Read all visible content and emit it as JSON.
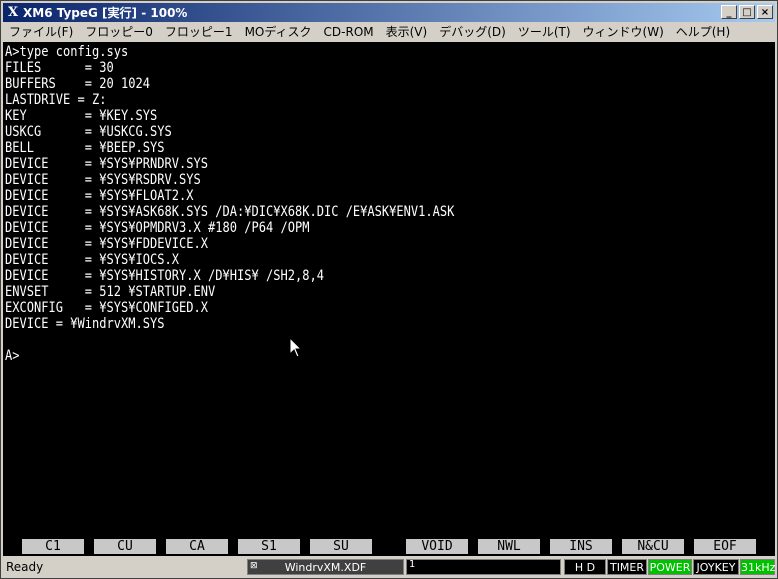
{
  "window": {
    "title": "XM6 TypeG [実行] - 100%",
    "app_icon": "X",
    "buttons": [
      "_",
      "□",
      "×"
    ]
  },
  "menu": [
    "ファイル(F)",
    "フロッピー0",
    "フロッピー1",
    "MOディスク",
    "CD-ROM",
    "表示(V)",
    "デバッグ(D)",
    "ツール(T)",
    "ウィンドウ(W)",
    "ヘルプ(H)"
  ],
  "terminal": {
    "lines": [
      "A>type config.sys",
      "FILES      = 30",
      "BUFFERS    = 20 1024",
      "LASTDRIVE = Z:",
      "KEY        = ¥KEY.SYS",
      "USKCG      = ¥USKCG.SYS",
      "BELL       = ¥BEEP.SYS",
      "DEVICE     = ¥SYS¥PRNDRV.SYS",
      "DEVICE     = ¥SYS¥RSDRV.SYS",
      "DEVICE     = ¥SYS¥FLOAT2.X",
      "DEVICE     = ¥SYS¥ASK68K.SYS /DA:¥DIC¥X68K.DIC /E¥ASK¥ENV1.ASK",
      "DEVICE     = ¥SYS¥OPMDRV3.X #180 /P64 /OPM",
      "DEVICE     = ¥SYS¥FDDEVICE.X",
      "DEVICE     = ¥SYS¥IOCS.X",
      "DEVICE     = ¥SYS¥HISTORY.X /D¥HIS¥ /SH2,8,4",
      "ENVSET     = 512 ¥STARTUP.ENV",
      "EXCONFIG   = ¥SYS¥CONFIGED.X",
      "DEVICE = ¥WindrvXM.SYS",
      "",
      "A>"
    ]
  },
  "fkeys": [
    "C1",
    "CU",
    "CA",
    "S1",
    "SU",
    "VOID",
    "NWL",
    "INS",
    "N&CU",
    "EOF"
  ],
  "status": {
    "ready": "Ready",
    "file": "WindrvXM.XDF",
    "file_icon": "⊠",
    "number": "1",
    "hd": "H D",
    "timer": "TIMER",
    "power": "POWER",
    "joykey": "JOYKEY",
    "freq": "31kHz"
  },
  "colors": {
    "power_bg": "#00c000",
    "freq_bg": "#00c000",
    "titlebar_start": "#0a246a",
    "titlebar_end": "#a6caf0"
  }
}
